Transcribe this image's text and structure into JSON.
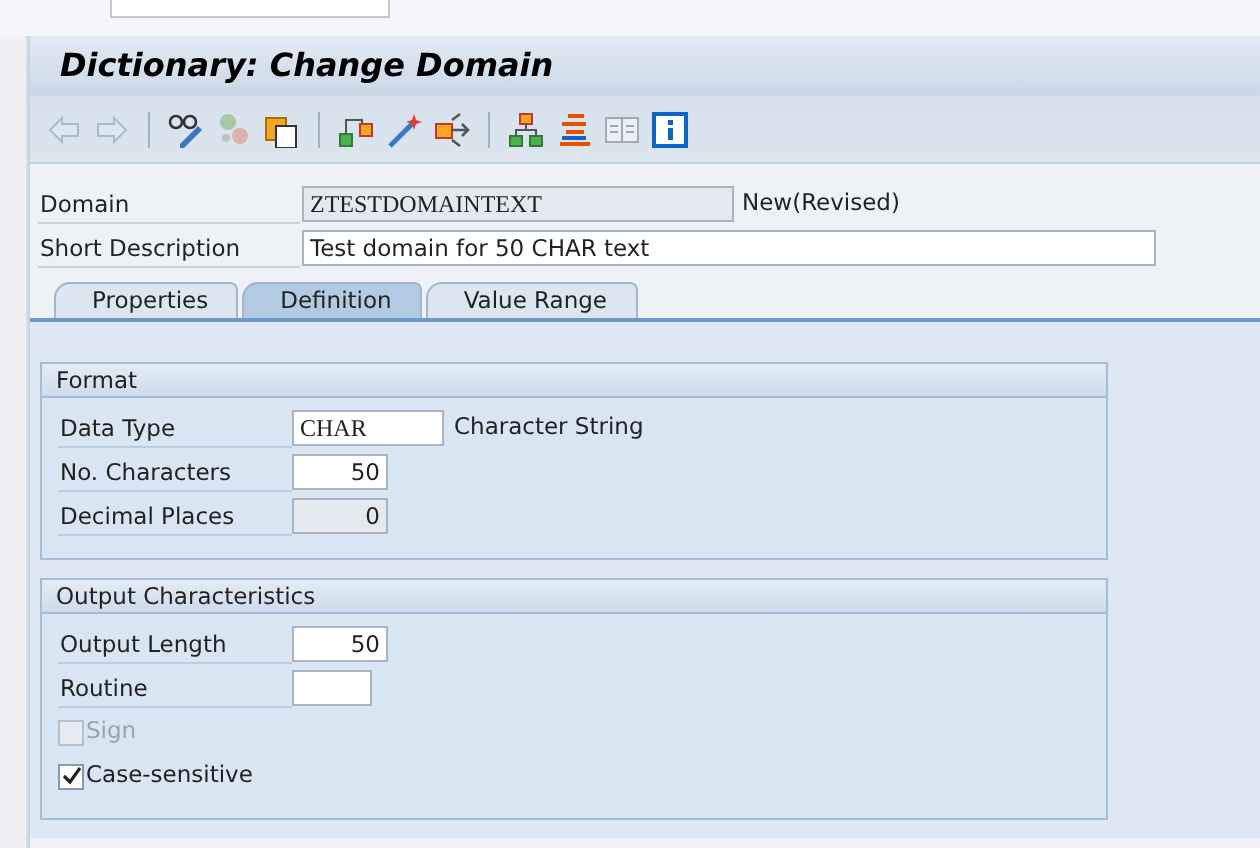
{
  "window": {
    "title": "Dictionary: Change Domain"
  },
  "toolbar": [
    [
      {
        "kind": "back",
        "disabled": true
      },
      {
        "kind": "forward",
        "disabled": true
      }
    ],
    [
      {
        "kind": "display-change",
        "disabled": false
      },
      {
        "kind": "other-object",
        "disabled": true
      },
      {
        "kind": "copy",
        "disabled": false
      }
    ],
    [
      {
        "kind": "where-used",
        "disabled": false
      },
      {
        "kind": "activate",
        "disabled": false
      },
      {
        "kind": "test",
        "disabled": false
      }
    ],
    [
      {
        "kind": "hierarchy",
        "disabled": false
      },
      {
        "kind": "stack",
        "disabled": false
      },
      {
        "kind": "list",
        "disabled": true
      },
      {
        "kind": "info",
        "disabled": false
      }
    ]
  ],
  "header_fields": [
    {
      "label": "Domain",
      "value": "ZTESTDOMAINTEXT",
      "disabled": true,
      "status": "New(Revised)"
    },
    {
      "label": "Short Description",
      "value": "Test domain for 50 CHAR text",
      "disabled": false
    }
  ],
  "tabs": [
    {
      "label": "Properties",
      "selected": false
    },
    {
      "label": "Definition",
      "selected": true
    },
    {
      "label": "Value Range",
      "selected": false
    }
  ],
  "groups": [
    {
      "title": "Format",
      "rows": [
        {
          "kind": "text",
          "label": "Data Type",
          "value": "CHAR",
          "disabled": false,
          "note": "Character String"
        },
        {
          "kind": "number",
          "label": "No. Characters",
          "value": "50",
          "disabled": false
        },
        {
          "kind": "number",
          "label": "Decimal Places",
          "value": "0",
          "disabled": true
        }
      ]
    },
    {
      "title": "Output Characteristics",
      "rows": [
        {
          "kind": "number",
          "label": "Output Length",
          "value": "50",
          "disabled": false
        },
        {
          "kind": "code",
          "label": "Routine",
          "disabled": false
        },
        {
          "kind": "checkbox",
          "label": "Sign",
          "checked": false,
          "disabled": true
        },
        {
          "kind": "checkbox",
          "label": "Case-sensitive",
          "checked": true,
          "disabled": false
        }
      ]
    }
  ]
}
